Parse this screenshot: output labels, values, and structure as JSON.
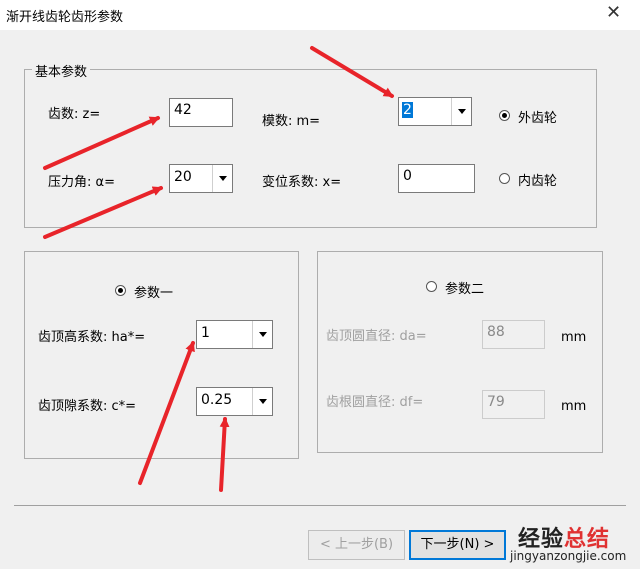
{
  "window": {
    "title": "渐开线齿轮齿形参数",
    "close_glyph": "✕"
  },
  "basic": {
    "legend": "基本参数",
    "teeth_label": "齿数:   z=",
    "teeth_value": "42",
    "module_label": "模数:   m=",
    "module_value": "2",
    "external_label": "外齿轮",
    "external_checked": true,
    "pressure_label": "压力角:  α=",
    "pressure_value": "20",
    "shift_label": "变位系数: x=",
    "shift_value": "0",
    "internal_label": "内齿轮",
    "internal_checked": false
  },
  "param1": {
    "radio_label": "参数一",
    "checked": true,
    "addendum_label": "齿顶高系数:  ha*=",
    "addendum_value": "1",
    "clearance_label": "齿顶隙系数:  c*=",
    "clearance_value": "0.25"
  },
  "param2": {
    "radio_label": "参数二",
    "checked": false,
    "tip_label": "齿顶圆直径:  da=",
    "tip_value": "88",
    "tip_unit": "mm",
    "root_label": "齿根圆直径:  df=",
    "root_value": "79",
    "root_unit": "mm"
  },
  "footer": {
    "prev_label": "< 上一步(B)",
    "next_label": "下一步(N) >"
  },
  "watermark": {
    "line1_a": "经验",
    "line1_b": "总结",
    "line2": "jingyanzongjie.com"
  },
  "colors": {
    "arrow": "#e8242a",
    "accent": "#0078d7",
    "window_bg": "#f0f0f0"
  }
}
